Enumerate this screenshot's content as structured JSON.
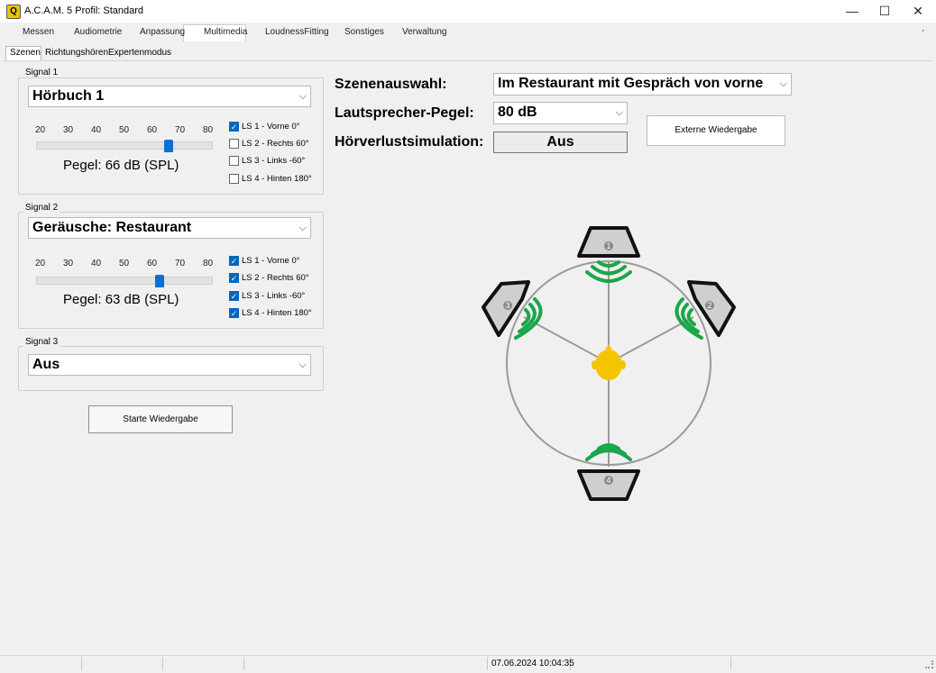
{
  "window": {
    "title": "A.C.A.M. 5  Profil: Standard",
    "app_icon_glyph": "Q",
    "minimize_glyph": "—",
    "maximize_glyph": "☐",
    "close_glyph": "✕"
  },
  "main_tabs": [
    "Messen",
    "Audiometrie",
    "Anpassung",
    "Multimedia",
    "LoudnessFitting",
    "Sonstiges",
    "Verwaltung"
  ],
  "menu_overflow": "·",
  "sub_tabs": [
    "Szenen",
    "Richtungshören",
    "Expertenmodus"
  ],
  "signal1": {
    "label": "Signal 1",
    "source": "Hörbuch 1",
    "ticks": [
      "20",
      "30",
      "40",
      "50",
      "60",
      "70",
      "80"
    ],
    "level_value": 66,
    "pegel": "Pegel: 66 dB (SPL)",
    "speakers": [
      {
        "label": "LS 1 - Vorne 0°",
        "checked": true
      },
      {
        "label": "LS 2 - Rechts 60°",
        "checked": false
      },
      {
        "label": "LS 3 - Links -60°",
        "checked": false
      },
      {
        "label": "LS 4 - Hinten 180°",
        "checked": false
      }
    ]
  },
  "signal2": {
    "label": "Signal 2",
    "source": "Geräusche: Restaurant",
    "ticks": [
      "20",
      "30",
      "40",
      "50",
      "60",
      "70",
      "80"
    ],
    "level_value": 63,
    "pegel": "Pegel: 63 dB (SPL)",
    "speakers": [
      {
        "label": "LS 1 - Vorne 0°",
        "checked": true
      },
      {
        "label": "LS 2 - Rechts 60°",
        "checked": true
      },
      {
        "label": "LS 3 - Links -60°",
        "checked": true
      },
      {
        "label": "LS 4 - Hinten 180°",
        "checked": true
      }
    ]
  },
  "signal3": {
    "label": "Signal 3",
    "source": "Aus"
  },
  "start_button": "Starte Wiedergabe",
  "scene": {
    "label": "Szenenauswahl:",
    "value": "Im Restaurant mit Gespräch von vorne",
    "speaker_level_label": "Lautsprecher-Pegel:",
    "speaker_level_value": "80 dB",
    "hearing_loss_label": "Hörverlustsimulation:",
    "hearing_loss_value": "Aus",
    "external_button": "Externe Wiedergabe"
  },
  "diagram": {
    "speaker_numbers": [
      "1",
      "2",
      "3",
      "4"
    ],
    "wave_color": "#1aa64a",
    "head_color": "#f5c400"
  },
  "checkmark": "✓",
  "dropdown_arrow": "⌵",
  "status": {
    "datetime": "07.06.2024 10:04:35"
  }
}
